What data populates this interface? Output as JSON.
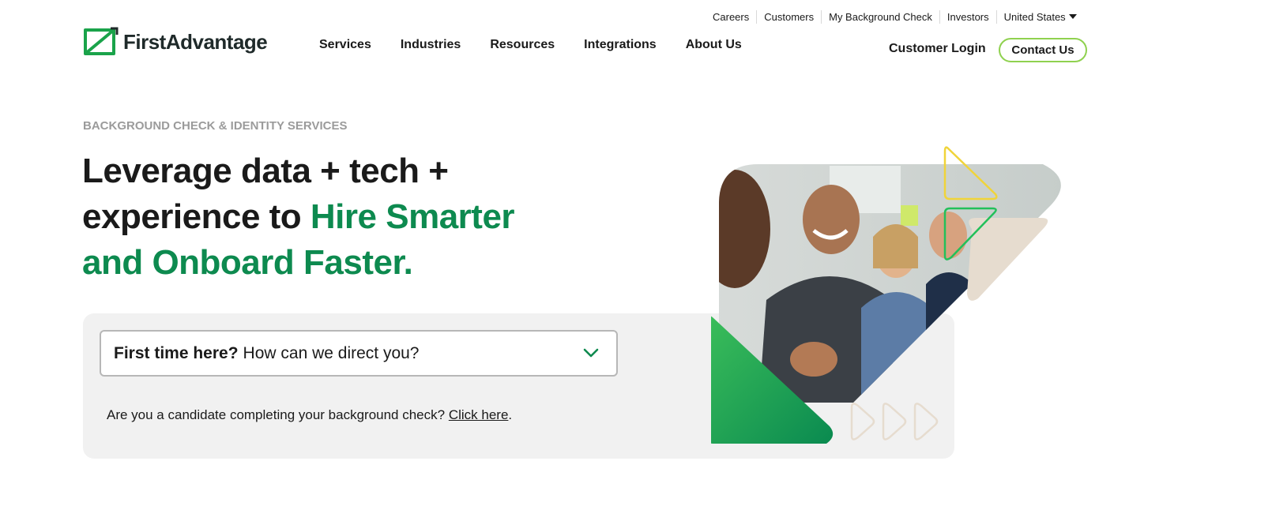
{
  "utility_nav": {
    "items": [
      "Careers",
      "Customers",
      "My Background Check",
      "Investors"
    ],
    "region": "United States"
  },
  "logo": {
    "text": "FirstAdvantage"
  },
  "main_nav": [
    "Services",
    "Industries",
    "Resources",
    "Integrations",
    "About Us"
  ],
  "header_actions": {
    "login": "Customer Login",
    "contact": "Contact Us"
  },
  "hero": {
    "eyebrow": "BACKGROUND CHECK & IDENTITY SERVICES",
    "headline_part1": "Leverage data + tech + experience to ",
    "headline_accent": "Hire Smarter and Onboard Faster."
  },
  "direct_select": {
    "bold_text": "First time here?",
    "text": "How can we direct you?"
  },
  "candidate": {
    "text": "Are you a candidate completing your background check? ",
    "link": "Click here",
    "suffix": "."
  },
  "colors": {
    "accent_green": "#0d8a4f",
    "button_border": "#8fd14f",
    "panel_bg": "#f1f1f1",
    "eyebrow": "#9b9b9b"
  },
  "icons": {
    "logo": "logo-mark-icon",
    "region_caret": "caret-down-icon",
    "select_chevron": "chevron-down-icon"
  }
}
